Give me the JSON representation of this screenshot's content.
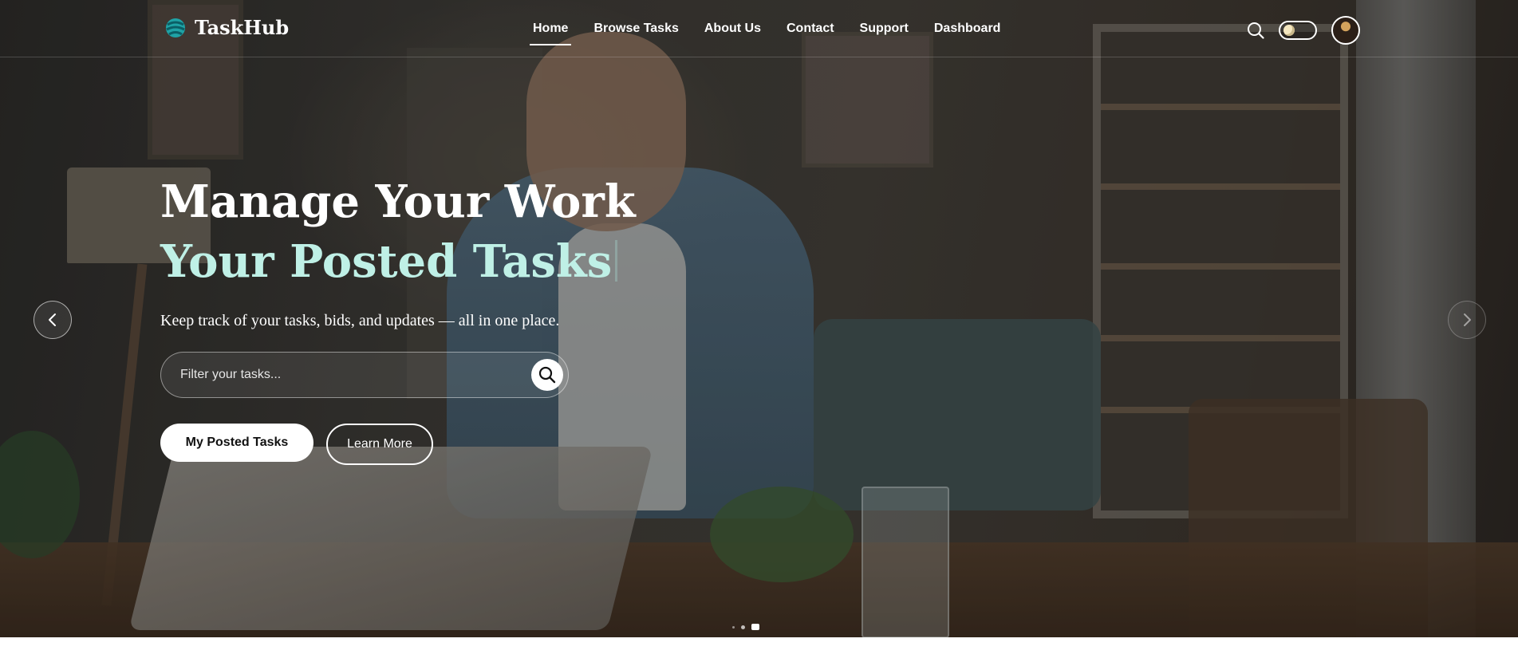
{
  "brand": {
    "name": "TaskHub"
  },
  "nav": {
    "links": [
      "Home",
      "Browse Tasks",
      "About Us",
      "Contact",
      "Support",
      "Dashboard"
    ],
    "active": "Home"
  },
  "hero": {
    "headline_part1": "Manage Your Work ",
    "headline_part2": "Your Posted Tasks",
    "subtitle": "Keep track of your tasks, bids, and updates — all in one place.",
    "search_placeholder": "Filter your tasks...",
    "primary_button": "My Posted Tasks",
    "secondary_button": "Learn More"
  },
  "carousel": {
    "slides": 3,
    "active_slide": 3
  },
  "colors": {
    "accent_text": "#bff0e6",
    "brand_logo": "#1fa3a6",
    "nav_text": "#ffffff"
  },
  "icons": {
    "brand": "globe-logo-icon",
    "search": "search-icon",
    "theme": "theme-toggle-icon",
    "prev": "chevron-left-icon",
    "next": "chevron-right-icon"
  }
}
